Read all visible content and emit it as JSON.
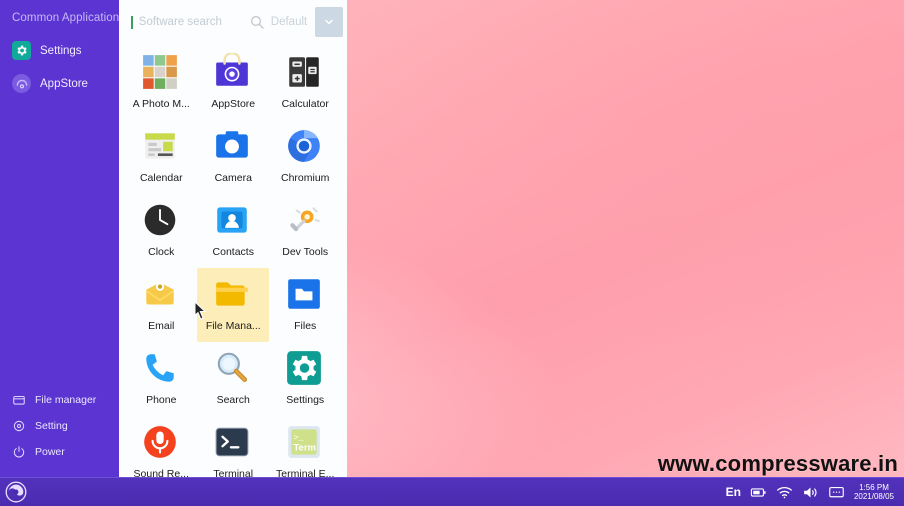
{
  "desktop": {
    "watermark": "www.compressware.in",
    "background_colors": [
      "#ffb9c1",
      "#ff9ead",
      "#ffbcc4"
    ]
  },
  "launcher": {
    "sidebar": {
      "title": "Common Application",
      "accent_color": "#5b34d1",
      "items": [
        {
          "label": "Settings",
          "icon": "gear-icon",
          "color": "#10a99a"
        },
        {
          "label": "AppStore",
          "icon": "appstore-icon",
          "color": "#7b5ce0"
        }
      ],
      "bottom_items": [
        {
          "label": "File manager",
          "icon": "folder-icon"
        },
        {
          "label": "Setting",
          "icon": "gear-icon"
        },
        {
          "label": "Power",
          "icon": "power-icon"
        }
      ]
    },
    "search": {
      "placeholder": "Software search",
      "value": "",
      "search_icon": "search-icon",
      "filter_label": "Default",
      "dropdown_icon": "chevron-down-icon"
    },
    "apps": [
      {
        "label": "A Photo M...",
        "icon": "photo-manager-icon",
        "selected": false
      },
      {
        "label": "AppStore",
        "icon": "appstore-icon",
        "selected": false
      },
      {
        "label": "Calculator",
        "icon": "calculator-icon",
        "selected": false
      },
      {
        "label": "Calendar",
        "icon": "calendar-icon",
        "selected": false
      },
      {
        "label": "Camera",
        "icon": "camera-icon",
        "selected": false
      },
      {
        "label": "Chromium",
        "icon": "chromium-icon",
        "selected": false
      },
      {
        "label": "Clock",
        "icon": "clock-icon",
        "selected": false
      },
      {
        "label": "Contacts",
        "icon": "contacts-icon",
        "selected": false
      },
      {
        "label": "Dev Tools",
        "icon": "dev-tools-icon",
        "selected": false
      },
      {
        "label": "Email",
        "icon": "email-icon",
        "selected": false
      },
      {
        "label": "File Mana...",
        "icon": "file-manager-icon",
        "selected": true
      },
      {
        "label": "Files",
        "icon": "files-icon",
        "selected": false
      },
      {
        "label": "Phone",
        "icon": "phone-icon",
        "selected": false
      },
      {
        "label": "Search",
        "icon": "search-magnifier-icon",
        "selected": false
      },
      {
        "label": "Settings",
        "icon": "settings-gear-icon",
        "selected": false
      },
      {
        "label": "Sound Re...",
        "icon": "sound-recorder-icon",
        "selected": false
      },
      {
        "label": "Terminal",
        "icon": "terminal-icon",
        "selected": false
      },
      {
        "label": "Terminal E...",
        "icon": "terminal-emulator-icon",
        "selected": false
      }
    ]
  },
  "taskbar": {
    "start_icon": "start-logo-icon",
    "background_color": "#4a2bb0",
    "tray": {
      "language": "En",
      "battery_icon": "battery-icon",
      "wifi_icon": "wifi-icon",
      "volume_icon": "volume-icon",
      "message_icon": "message-icon",
      "time": "1:56 PM",
      "date": "2021/08/05"
    }
  }
}
